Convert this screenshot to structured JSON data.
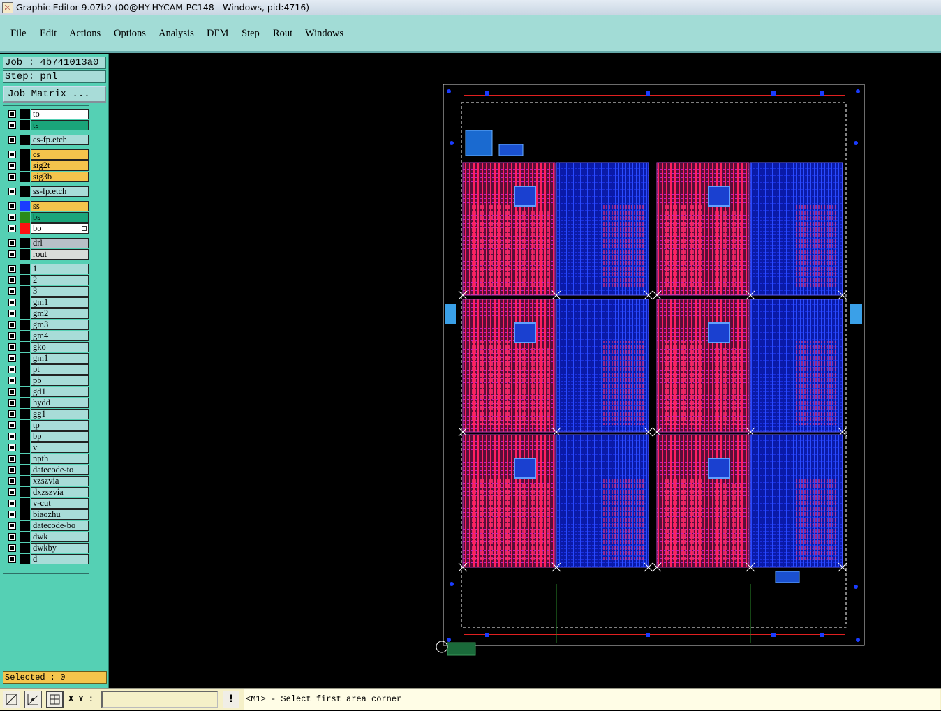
{
  "window": {
    "title": "Graphic Editor 9.07b2 (00@HY-HYCAM-PC148 - Windows, pid:4716)"
  },
  "menu": [
    "File",
    "Edit",
    "Actions",
    "Options",
    "Analysis",
    "DFM",
    "Step",
    "Rout",
    "Windows"
  ],
  "job": {
    "label": "Job : 4b741013a0",
    "step": "Step: pnl",
    "matrix_button": "Job Matrix ..."
  },
  "layers": [
    {
      "name": "to",
      "bg": "#ffffff",
      "swatch": "#000000",
      "group": 0
    },
    {
      "name": "ts",
      "bg": "#1aa57a",
      "swatch": "#000000",
      "group": 0
    },
    {
      "name": "cs-fp.etch",
      "bg": "#a8dcd8",
      "swatch": "#000000",
      "group": 1
    },
    {
      "name": "cs",
      "bg": "#f4c44c",
      "swatch": "#000000",
      "group": 2
    },
    {
      "name": "sig2t",
      "bg": "#f4c44c",
      "swatch": "#000000",
      "group": 2
    },
    {
      "name": "sig3b",
      "bg": "#f4c44c",
      "swatch": "#000000",
      "group": 2
    },
    {
      "name": "ss-fp.etch",
      "bg": "#a8dcd8",
      "swatch": "#000000",
      "group": 3
    },
    {
      "name": "ss",
      "bg": "#f4c44c",
      "swatch": "#1a3cff",
      "group": 4
    },
    {
      "name": "bs",
      "bg": "#1aa57a",
      "swatch": "#2a8a1a",
      "group": 4
    },
    {
      "name": "bo",
      "bg": "#ffffff",
      "swatch": "#ff1010",
      "group": 4,
      "marked": true
    },
    {
      "name": "drl",
      "bg": "#b8c0c8",
      "swatch": "#000000",
      "group": 5
    },
    {
      "name": "rout",
      "bg": "#d8dcd8",
      "swatch": "#000000",
      "group": 5
    },
    {
      "name": "1",
      "bg": "#a8dcd8",
      "swatch": "#000000",
      "group": 6
    },
    {
      "name": "2",
      "bg": "#a8dcd8",
      "swatch": "#000000",
      "group": 6
    },
    {
      "name": "3",
      "bg": "#a8dcd8",
      "swatch": "#000000",
      "group": 6
    },
    {
      "name": "gm1",
      "bg": "#a8dcd8",
      "swatch": "#000000",
      "group": 6
    },
    {
      "name": "gm2",
      "bg": "#a8dcd8",
      "swatch": "#000000",
      "group": 6
    },
    {
      "name": "gm3",
      "bg": "#a8dcd8",
      "swatch": "#000000",
      "group": 6
    },
    {
      "name": "gm4",
      "bg": "#a8dcd8",
      "swatch": "#000000",
      "group": 6
    },
    {
      "name": "gko",
      "bg": "#a8dcd8",
      "swatch": "#000000",
      "group": 6
    },
    {
      "name": "gm1",
      "bg": "#a8dcd8",
      "swatch": "#000000",
      "group": 6
    },
    {
      "name": "pt",
      "bg": "#a8dcd8",
      "swatch": "#000000",
      "group": 6
    },
    {
      "name": "pb",
      "bg": "#a8dcd8",
      "swatch": "#000000",
      "group": 6
    },
    {
      "name": "gd1",
      "bg": "#a8dcd8",
      "swatch": "#000000",
      "group": 6
    },
    {
      "name": "hydd",
      "bg": "#a8dcd8",
      "swatch": "#000000",
      "group": 6
    },
    {
      "name": "gg1",
      "bg": "#a8dcd8",
      "swatch": "#000000",
      "group": 6
    },
    {
      "name": "tp",
      "bg": "#a8dcd8",
      "swatch": "#000000",
      "group": 6
    },
    {
      "name": "bp",
      "bg": "#a8dcd8",
      "swatch": "#000000",
      "group": 6
    },
    {
      "name": "v",
      "bg": "#a8dcd8",
      "swatch": "#000000",
      "group": 6
    },
    {
      "name": "npth",
      "bg": "#a8dcd8",
      "swatch": "#000000",
      "group": 6
    },
    {
      "name": "datecode-to",
      "bg": "#a8dcd8",
      "swatch": "#000000",
      "group": 6
    },
    {
      "name": "xzszvia",
      "bg": "#a8dcd8",
      "swatch": "#000000",
      "group": 6
    },
    {
      "name": "dxzszvia",
      "bg": "#a8dcd8",
      "swatch": "#000000",
      "group": 6
    },
    {
      "name": "v-cut",
      "bg": "#a8dcd8",
      "swatch": "#000000",
      "group": 6
    },
    {
      "name": "biaozhu",
      "bg": "#a8dcd8",
      "swatch": "#000000",
      "group": 6
    },
    {
      "name": "datecode-bo",
      "bg": "#a8dcd8",
      "swatch": "#000000",
      "group": 6
    },
    {
      "name": "dwk",
      "bg": "#a8dcd8",
      "swatch": "#000000",
      "group": 6
    },
    {
      "name": "dwkby",
      "bg": "#a8dcd8",
      "swatch": "#000000",
      "group": 6
    },
    {
      "name": "d",
      "bg": "#a8dcd8",
      "swatch": "#000000",
      "group": 6
    }
  ],
  "status": {
    "selected": "Selected : 0",
    "xy_label": "X Y :",
    "xy_value": "",
    "warning_glyph": "!",
    "message": "<M1> - Select first area corner"
  },
  "tools": [
    "zoom-area-icon",
    "snap-icon",
    "grid-icon"
  ],
  "colors": {
    "menubar": "#a2dcd6",
    "panel": "#55d0b4",
    "canvas": "#000000",
    "signal_top": "#ff1493",
    "signal_bottom": "#1a3cff"
  }
}
